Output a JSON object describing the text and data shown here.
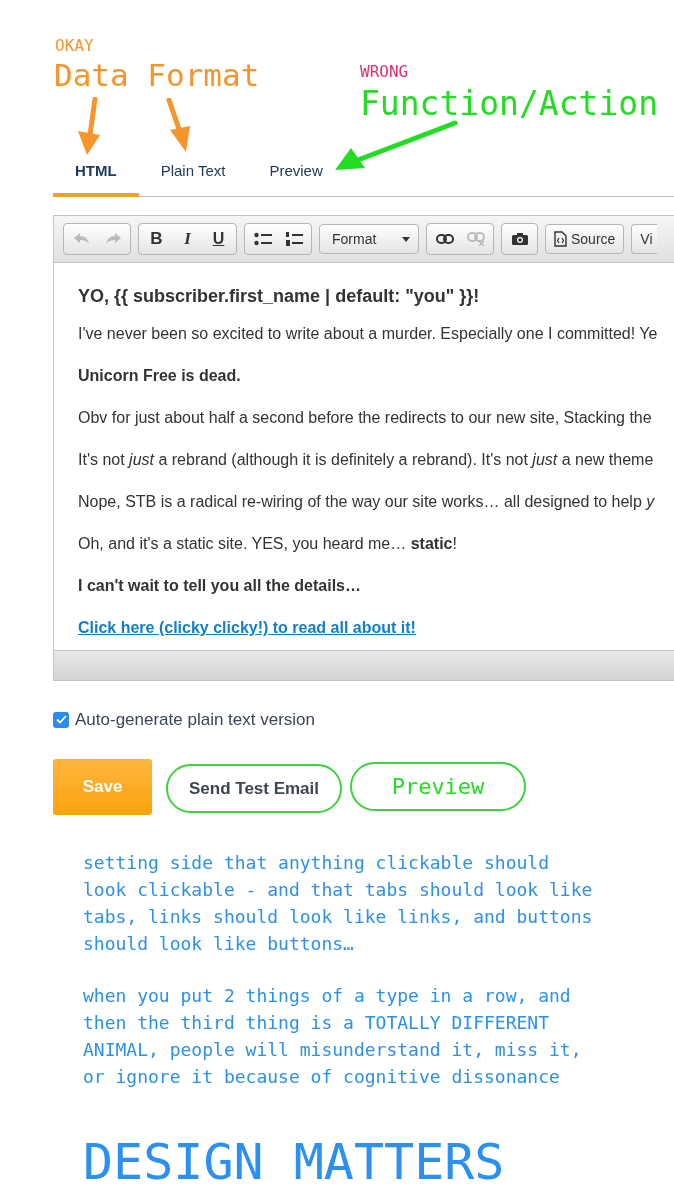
{
  "annotations": {
    "okay": "OKAY",
    "data_format": "Data Format",
    "wrong": "WRONG",
    "function_action": "Function/Action"
  },
  "tabs": [
    {
      "label": "HTML",
      "selected": true
    },
    {
      "label": "Plain Text",
      "selected": false
    },
    {
      "label": "Preview",
      "selected": false
    }
  ],
  "toolbar": {
    "undo": {
      "disabled": true
    },
    "redo": {
      "disabled": true
    },
    "unlink": {
      "disabled": true
    },
    "bold": "B",
    "italic": "I",
    "underline": "U",
    "format": "Format",
    "source": "Source",
    "view": "Vi"
  },
  "editor": [
    {
      "kind": "heading",
      "text": "YO, {{ subscriber.first_name | default: \"you\" }}!"
    },
    {
      "kind": "text",
      "text": "I've never been so excited to write about a murder. Especially one I committed! Ye"
    },
    {
      "kind": "bold",
      "text": "Unicorn Free is dead."
    },
    {
      "kind": "text",
      "text": "Obv for just about half a second before the redirects to our new site, Stacking the"
    },
    {
      "kind": "text",
      "text": "It's not *just* a rebrand (although it is definitely a rebrand). It's not *just* a new theme"
    },
    {
      "kind": "text",
      "text": "Nope, STB is a radical re-wiring of the way our site works… all designed to help *y*"
    },
    {
      "kind": "text",
      "text": "Oh, and it's a static site. YES, you heard me… **static**!"
    },
    {
      "kind": "bold",
      "text": "I can't wait to tell you all the details…"
    },
    {
      "kind": "link",
      "text": "Click here (clicky clicky!) to read all about it!"
    }
  ],
  "checkbox": {
    "label": "Auto-generate plain text version",
    "checked": true
  },
  "buttons": [
    {
      "label": "Save",
      "kind": "primary"
    },
    {
      "label": "Send Test Email",
      "kind": "outline"
    },
    {
      "label": "Preview",
      "kind": "annotated"
    }
  ],
  "notes": [
    "setting side that anything clickable should look clickable - and that tabs should look like tabs, links should look like links, and buttons should look like buttons…",
    "when you put 2 things of a type in a row, and then the third thing is a TOTALLY DIFFERENT ANIMAL, people will misunderstand it, miss it, or ignore it because of cognitive dissonance"
  ],
  "footer": "DESIGN MATTERS"
}
